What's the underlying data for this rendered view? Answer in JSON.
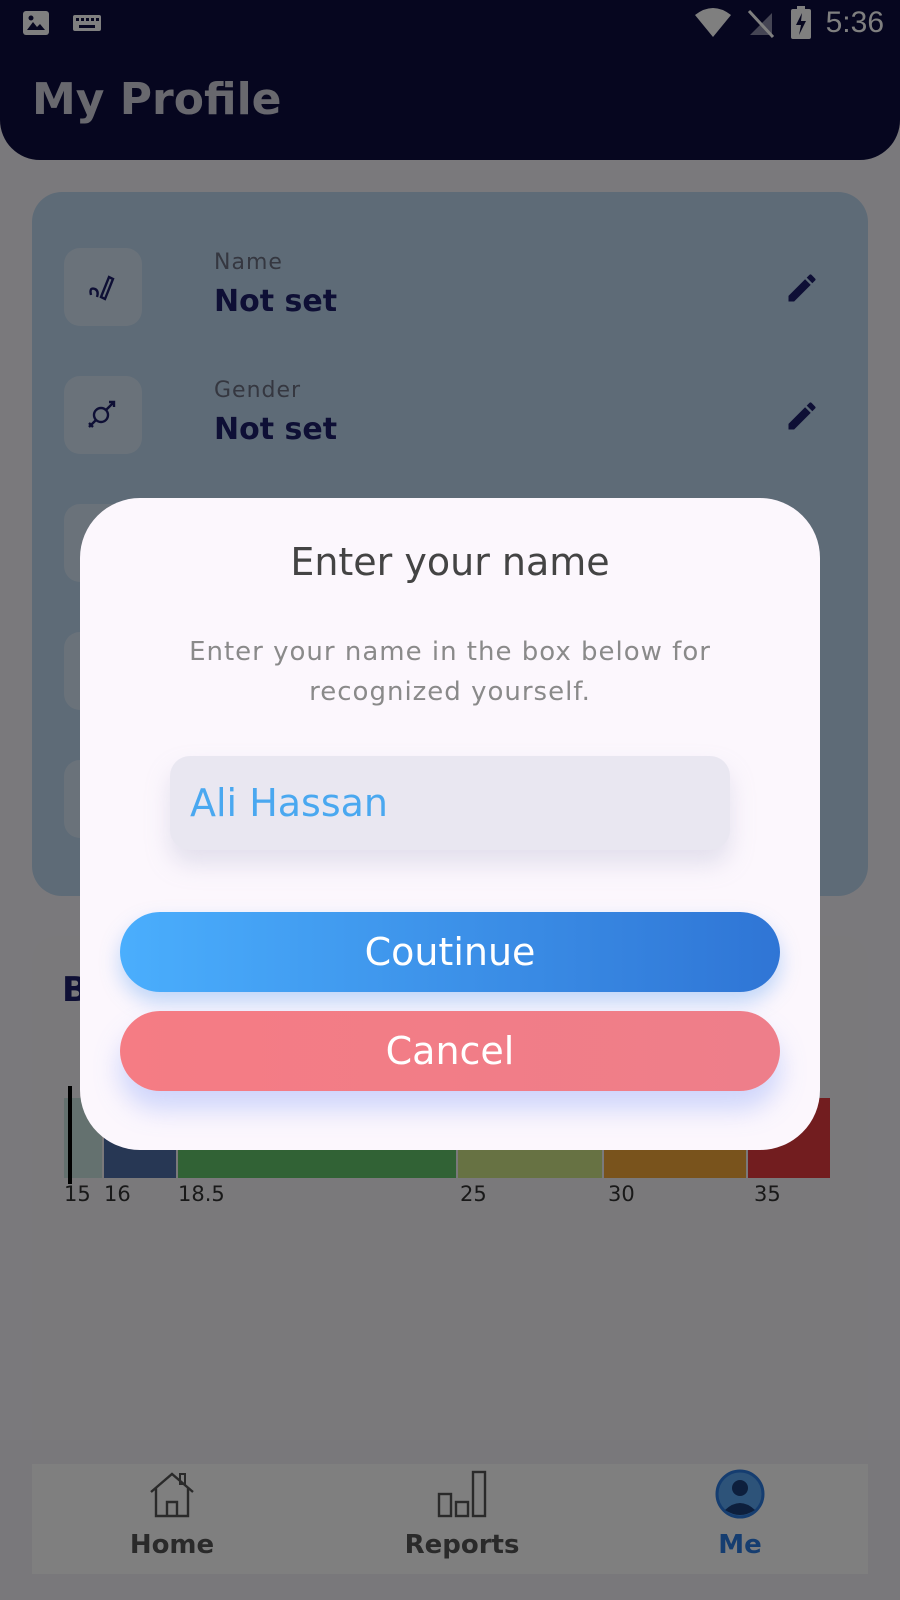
{
  "status_bar": {
    "time": "5:36"
  },
  "header": {
    "title": "My Profile"
  },
  "profile": {
    "rows": [
      {
        "label": "Name",
        "value": "Not set"
      },
      {
        "label": "Gender",
        "value": "Not set"
      }
    ]
  },
  "bmi": {
    "title_partial": "B",
    "ticks": [
      "15",
      "16",
      "18.5",
      "25",
      "30",
      "35"
    ],
    "segment_colors": [
      "#c9e3df",
      "#4e6fa8",
      "#62c46a",
      "#cfe587",
      "#f2a739",
      "#e43a3e"
    ]
  },
  "nav": {
    "items": [
      {
        "label": "Home",
        "icon": "home-icon"
      },
      {
        "label": "Reports",
        "icon": "reports-icon"
      },
      {
        "label": "Me",
        "icon": "user-icon"
      }
    ],
    "active_color": "#2a7ae0"
  },
  "dialog": {
    "title": "Enter your name",
    "subtitle": "Enter your name in the box below for recognized yourself.",
    "input_value": "Ali Hassan",
    "continue_label": "Coutinue",
    "cancel_label": "Cancel"
  }
}
